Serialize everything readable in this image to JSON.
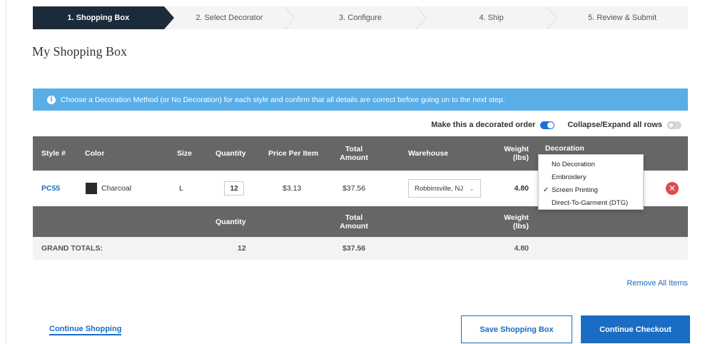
{
  "stepper": {
    "steps": [
      {
        "label": "1. Shopping Box",
        "active": true
      },
      {
        "label": "2. Select Decorator",
        "active": false
      },
      {
        "label": "3. Configure",
        "active": false
      },
      {
        "label": "4. Ship",
        "active": false
      },
      {
        "label": "5. Review & Submit",
        "active": false
      }
    ]
  },
  "page_title": "My Shopping Box",
  "info_bar": {
    "icon": "info-icon",
    "text": "Choose a Decoration Method (or No Decoration) for each style and confirm that all details are correct before going on to the next step."
  },
  "toggles": {
    "decorated_label": "Make this a decorated order",
    "decorated_on": true,
    "collapse_label": "Collapse/Expand all rows",
    "collapse_on": false
  },
  "table": {
    "headers": {
      "style": "Style #",
      "color": "Color",
      "size": "Size",
      "quantity": "Quantity",
      "price": "Price Per Item",
      "total_1": "Total",
      "total_2": "Amount",
      "warehouse": "Warehouse",
      "weight_1": "Weight",
      "weight_2": "(lbs)",
      "decoration": "Decoration"
    },
    "row": {
      "style": "PC55",
      "color": "Charcoal",
      "size": "L",
      "quantity": "12",
      "price": "$3.13",
      "total": "$37.56",
      "warehouse": "Robbinsville, NJ",
      "weight": "4.80"
    },
    "summary_headers": {
      "quantity": "Quantity",
      "total_1": "Total",
      "total_2": "Amount",
      "weight_1": "Weight",
      "weight_2": "(lbs)"
    },
    "grand_totals": {
      "label": "GRAND TOTALS:",
      "quantity": "12",
      "total": "$37.56",
      "weight": "4.80"
    }
  },
  "decoration_dropdown": {
    "options": [
      "No Decoration",
      "Embroidery",
      "Screen Printing",
      "Direct-To-Garment (DTG)"
    ],
    "selected": "Screen Printing",
    "check_glyph": "✓"
  },
  "links": {
    "remove_all": "Remove All Items",
    "continue_shopping": "Continue Shopping"
  },
  "buttons": {
    "save": "Save Shopping Box",
    "checkout": "Continue Checkout"
  },
  "colors": {
    "nav_active": "#1b2b3a",
    "info_bar": "#5aaee8",
    "table_header": "#666666",
    "link_blue": "#1a6cc4",
    "remove_red": "#e0484f"
  }
}
